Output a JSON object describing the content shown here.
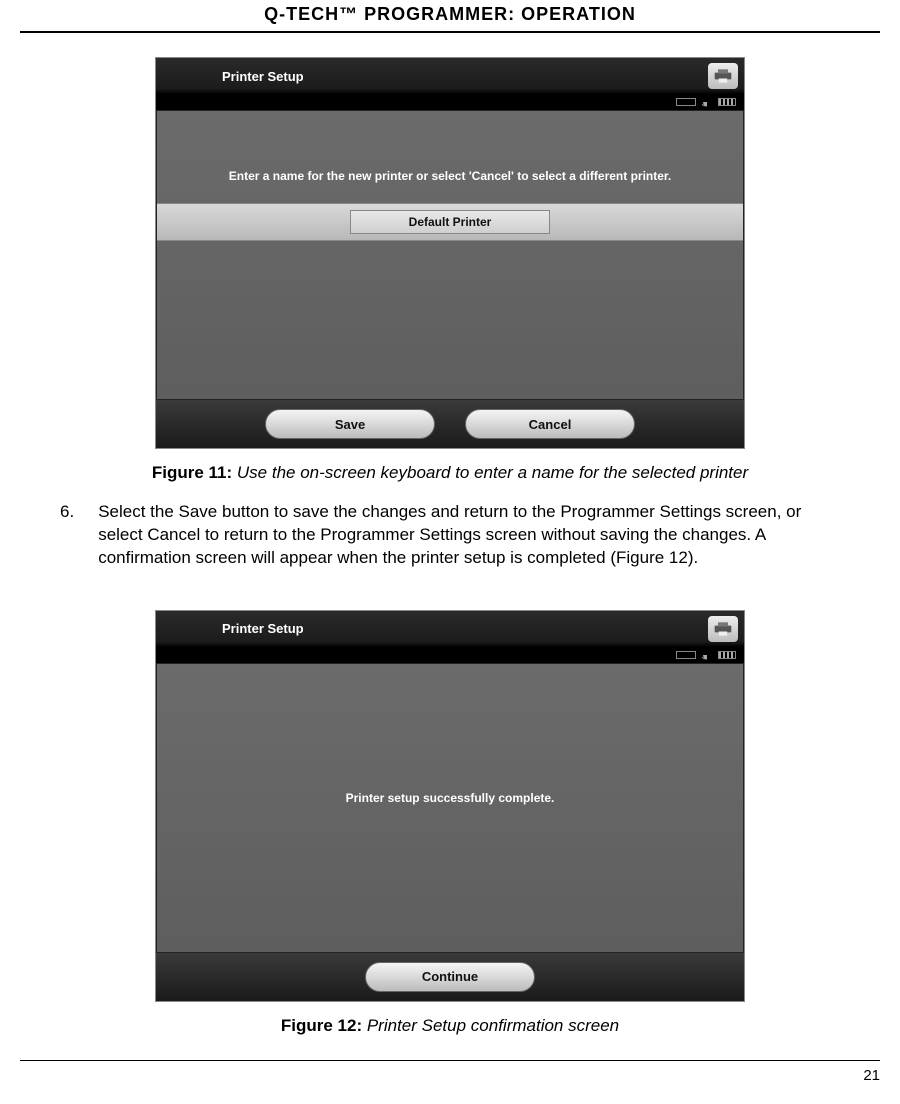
{
  "header": "Q-TECH™ PROGRAMMER:  OPERATION",
  "page_number": "21",
  "figure11": {
    "label": "Figure 11:",
    "caption": "Use the on-screen keyboard to enter a name for the selected printer",
    "screen": {
      "title": "Printer Setup",
      "prompt": "Enter a name for the new printer or select 'Cancel' to select a different printer.",
      "input_value": "Default Printer",
      "save_label": "Save",
      "cancel_label": "Cancel"
    }
  },
  "step6": {
    "num": "6.",
    "text": "Select the Save button to save the changes and return to the Programmer Settings screen, or select Cancel to return to the Programmer Settings screen without saving the changes. A confirmation screen will appear when the printer setup is completed (Figure 12)."
  },
  "figure12": {
    "label": "Figure 12:",
    "caption": "Printer Setup confirmation screen",
    "screen": {
      "title": "Printer Setup",
      "message": "Printer setup successfully complete.",
      "continue_label": "Continue"
    }
  }
}
